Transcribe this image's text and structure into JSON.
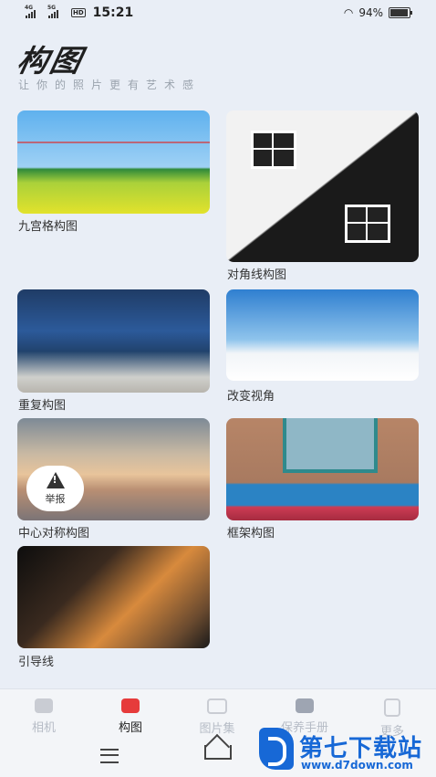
{
  "status_bar": {
    "time": "15:21",
    "battery": "94%",
    "net1": "4G",
    "net2": "5G",
    "hd": "HD"
  },
  "header": {
    "title": "构图",
    "subtitle": "让你的照片更有艺术感"
  },
  "cards": [
    {
      "label": "九宫格构图"
    },
    {
      "label": "对角线构图"
    },
    {
      "label": "重复构图"
    },
    {
      "label": "改变视角"
    },
    {
      "label": "中心对称构图"
    },
    {
      "label": "框架构图"
    },
    {
      "label": "引导线"
    }
  ],
  "report": {
    "label": "举报"
  },
  "tabs": [
    {
      "label": "相机",
      "icon": "camera-icon",
      "active": false
    },
    {
      "label": "构图",
      "icon": "composition-icon",
      "active": true
    },
    {
      "label": "图片集",
      "icon": "gallery-icon",
      "active": false
    },
    {
      "label": "保养手册",
      "icon": "camera-care-icon",
      "active": false
    },
    {
      "label": "更多",
      "icon": "person-icon",
      "active": false
    }
  ],
  "watermark": {
    "text": "第七下载站",
    "url": "www.d7down.com"
  },
  "colors": {
    "background": "#e9eef6",
    "active_tab": "#e63b3b",
    "watermark": "#1768d6"
  }
}
